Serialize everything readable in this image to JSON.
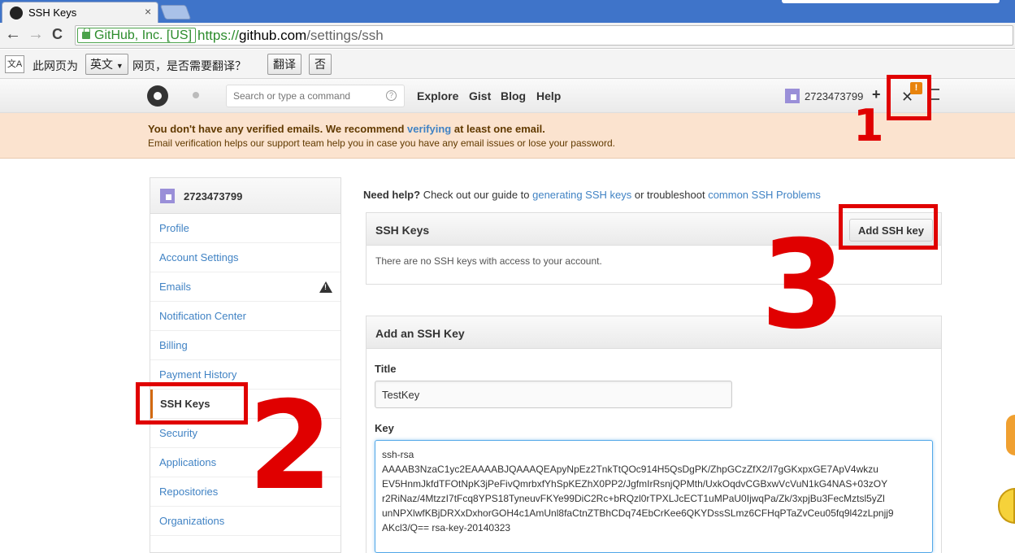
{
  "browser": {
    "tab_title": "SSH Keys",
    "tab_close": "×",
    "back": "←",
    "forward": "→",
    "reload": "C",
    "ev_label": "GitHub, Inc. [US]",
    "url_scheme": "https://",
    "url_host": "github.com",
    "url_path": "/settings/ssh"
  },
  "translate_bar": {
    "icon_text": "文A",
    "prefix": "此网页为",
    "language": "英文",
    "suffix": "网页，是否需要翻译？",
    "translate_button": "翻译",
    "no_button": "否"
  },
  "header": {
    "search_placeholder": "Search or type a command",
    "help_glyph": "?",
    "nav": [
      "Explore",
      "Gist",
      "Blog",
      "Help"
    ],
    "username": "2723473799",
    "plus": "+",
    "tools_glyph": "✕",
    "alert_badge": "!"
  },
  "flash": {
    "line1_before": "You don't have any verified emails. We recommend ",
    "line1_link": "verifying",
    "line1_after": " at least one email.",
    "line2": "Email verification helps our support team help you in case you have any email issues or lose your password."
  },
  "sidebar": {
    "username": "2723473799",
    "items": [
      {
        "label": "Profile"
      },
      {
        "label": "Account Settings"
      },
      {
        "label": "Emails"
      },
      {
        "label": "Notification Center"
      },
      {
        "label": "Billing"
      },
      {
        "label": "Payment History"
      },
      {
        "label": "SSH Keys"
      },
      {
        "label": "Security"
      },
      {
        "label": "Applications"
      },
      {
        "label": "Repositories"
      },
      {
        "label": "Organizations"
      }
    ]
  },
  "help": {
    "lead": "Need help?",
    "text1": " Check out our guide to ",
    "link1": "generating SSH keys",
    "text2": " or troubleshoot ",
    "link2": "common SSH Problems"
  },
  "ssh_keys_box": {
    "heading": "SSH Keys",
    "add_button": "Add SSH key",
    "empty_text": "There are no SSH keys with access to your account."
  },
  "add_key_box": {
    "heading": "Add an SSH Key",
    "title_label": "Title",
    "title_value": "TestKey",
    "key_label": "Key",
    "key_lines": [
      "ssh-rsa",
      "AAAAB3NzaC1yc2EAAAABJQAAAQEApyNpEz2TnkTtQOc914H5QsDgPK/ZhpGCzZfX2/I7gGKxpxGE7ApV4wkzu",
      "EV5HnmJkfdTFOtNpK3jPeFivQmrbxfYhSpKEZhX0PP2/JgfmIrRsnjQPMth/UxkOqdvCGBxwVcVuN1kG4NAS+03zOY",
      "r2RiNaz/4MtzzI7tFcq8YPS18TyneuvFKYe99DiC2Rc+bRQzl0rTPXLJcECT1uMPaU0IjwqPa/Zk/3xpjBu3FecMztsl5yZl",
      "unNPXlwfKBjDRXxDxhorGOH4c1AmUnl8faCtnZTBhCDq74EbCrKee6QKYDssSLmz6CFHqPTaZvCeu05fq9l42zLpnjj9",
      "AKcl3/Q== rsa-key-20140323"
    ]
  },
  "annotations": {
    "one": "1",
    "two": "2",
    "three": "3"
  },
  "colors": {
    "annotation": "#e00000",
    "link": "#4183c4",
    "flash_bg": "#fbe3cf",
    "selected_border": "#d26911",
    "ev_green": "#2c8c2c"
  }
}
